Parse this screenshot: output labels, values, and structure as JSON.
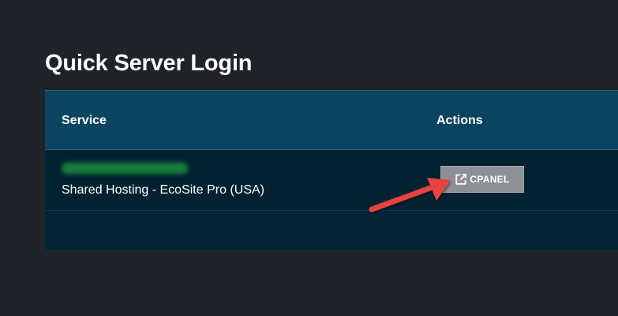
{
  "page": {
    "title": "Quick Server Login"
  },
  "table": {
    "columns": {
      "service": "Service",
      "actions": "Actions"
    },
    "rows": [
      {
        "service_name": "Shared Hosting - EcoSite Pro (USA)",
        "action_label": "CPANEL"
      }
    ]
  },
  "colors": {
    "background": "#21232b",
    "header": "#0b4461",
    "row": "#032231",
    "button": "#8e9095",
    "arrow": "#e8423f"
  },
  "icons": {
    "action_icon": "external-link-icon"
  }
}
